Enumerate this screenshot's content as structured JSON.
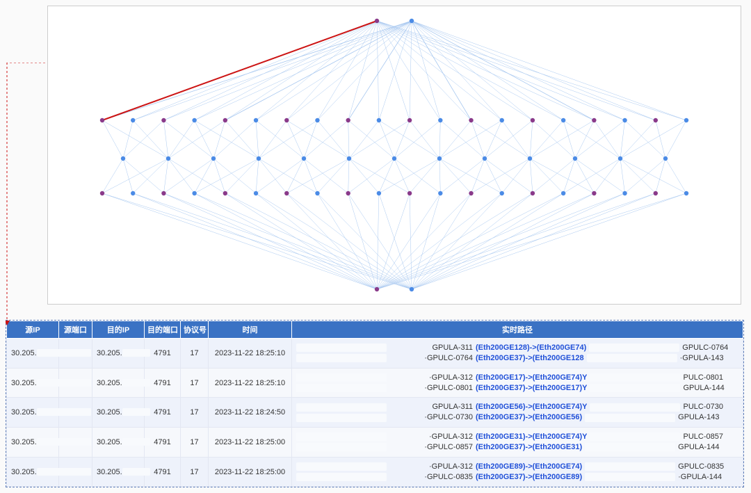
{
  "table": {
    "headers": {
      "src_ip": "源IP",
      "src_port": "源端口",
      "dst_ip": "目的IP",
      "dst_port": "目的端口",
      "proto": "协议号",
      "time": "时间",
      "rt_path": "实时路径"
    },
    "rows": [
      {
        "src_ip": "30.205.",
        "dst_ip": "30.205.",
        "dst_port": "4791",
        "proto": "17",
        "time": "2023-11-22 18:25:10",
        "rt_path": [
          {
            "prefix": "GPULA-311",
            "mid": "(Eth200GE128)->(Eth200GE74)",
            "suffix": "GPULC-0764"
          },
          {
            "prefix": "·GPULC-0764",
            "mid": "(Eth200GE37)->(Eth200GE128",
            "suffix": "·GPULA-143"
          }
        ]
      },
      {
        "src_ip": "30.205.",
        "dst_ip": "30.205.",
        "dst_port": "4791",
        "proto": "17",
        "time": "2023-11-22 18:25:10",
        "rt_path": [
          {
            "prefix": "·GPULA-312",
            "mid": "(Eth200GE17)->(Eth200GE74)Y",
            "suffix": "PULC-0801"
          },
          {
            "prefix": "·GPULC-0801",
            "mid": "(Eth200GE37)->(Eth200GE17)Y",
            "suffix": "GPULA-144"
          }
        ]
      },
      {
        "src_ip": "30.205.",
        "dst_ip": "30.205.",
        "dst_port": "4791",
        "proto": "17",
        "time": "2023-11-22 18:24:50",
        "rt_path": [
          {
            "prefix": "GPULA-311",
            "mid": "(Eth200GE56)->(Eth200GE74)Y",
            "suffix": "PULC-0730"
          },
          {
            "prefix": "·GPULC-0730",
            "mid": "(Eth200GE37)->(Eth200GE56)",
            "suffix": "GPULA-143"
          }
        ]
      },
      {
        "src_ip": "30.205.",
        "dst_ip": "30.205.",
        "dst_port": "4791",
        "proto": "17",
        "time": "2023-11-22 18:25:00",
        "rt_path": [
          {
            "prefix": "·GPULA-312",
            "mid": "(Eth200GE31)->(Eth200GE74)Y",
            "suffix": "PULC-0857"
          },
          {
            "prefix": "·GPULC-0857",
            "mid": "(Eth200GE37)->(Eth200GE31)",
            "suffix": "GPULA-144"
          }
        ]
      },
      {
        "src_ip": "30.205.",
        "dst_ip": "30.205.",
        "dst_port": "4791",
        "proto": "17",
        "time": "2023-11-22 18:25:00",
        "rt_path": [
          {
            "prefix": "·GPULA-312",
            "mid": "(Eth200GE89)->(Eth200GE74)",
            "suffix": "GPULC-0835"
          },
          {
            "prefix": "·GPULC-0835",
            "mid": "(Eth200GE37)->(Eth200GE89)",
            "suffix": "·GPULA-144"
          }
        ]
      }
    ]
  },
  "topology": {
    "layers": {
      "top": {
        "count": 2,
        "kinds": [
          "purple",
          "blue"
        ]
      },
      "second": {
        "count": 20,
        "kinds": [
          "pb_alt"
        ]
      },
      "third": {
        "count": 13,
        "kinds": [
          "blue"
        ]
      },
      "fourth": {
        "count": 20,
        "kinds": [
          "pb_alt"
        ]
      },
      "bottom": {
        "count": 2,
        "kinds": [
          "purple",
          "blue"
        ]
      }
    },
    "highlighted_edge": {
      "from": "top-0",
      "to": "layer2-0",
      "color": "#cc1414"
    }
  },
  "colors": {
    "node_blue": "#4b8be6",
    "node_purple": "#8a3a8a",
    "link_blue_bold": "#4b8be6",
    "link_blue_light": "#a8c8f0",
    "link_red": "#cc1414"
  }
}
